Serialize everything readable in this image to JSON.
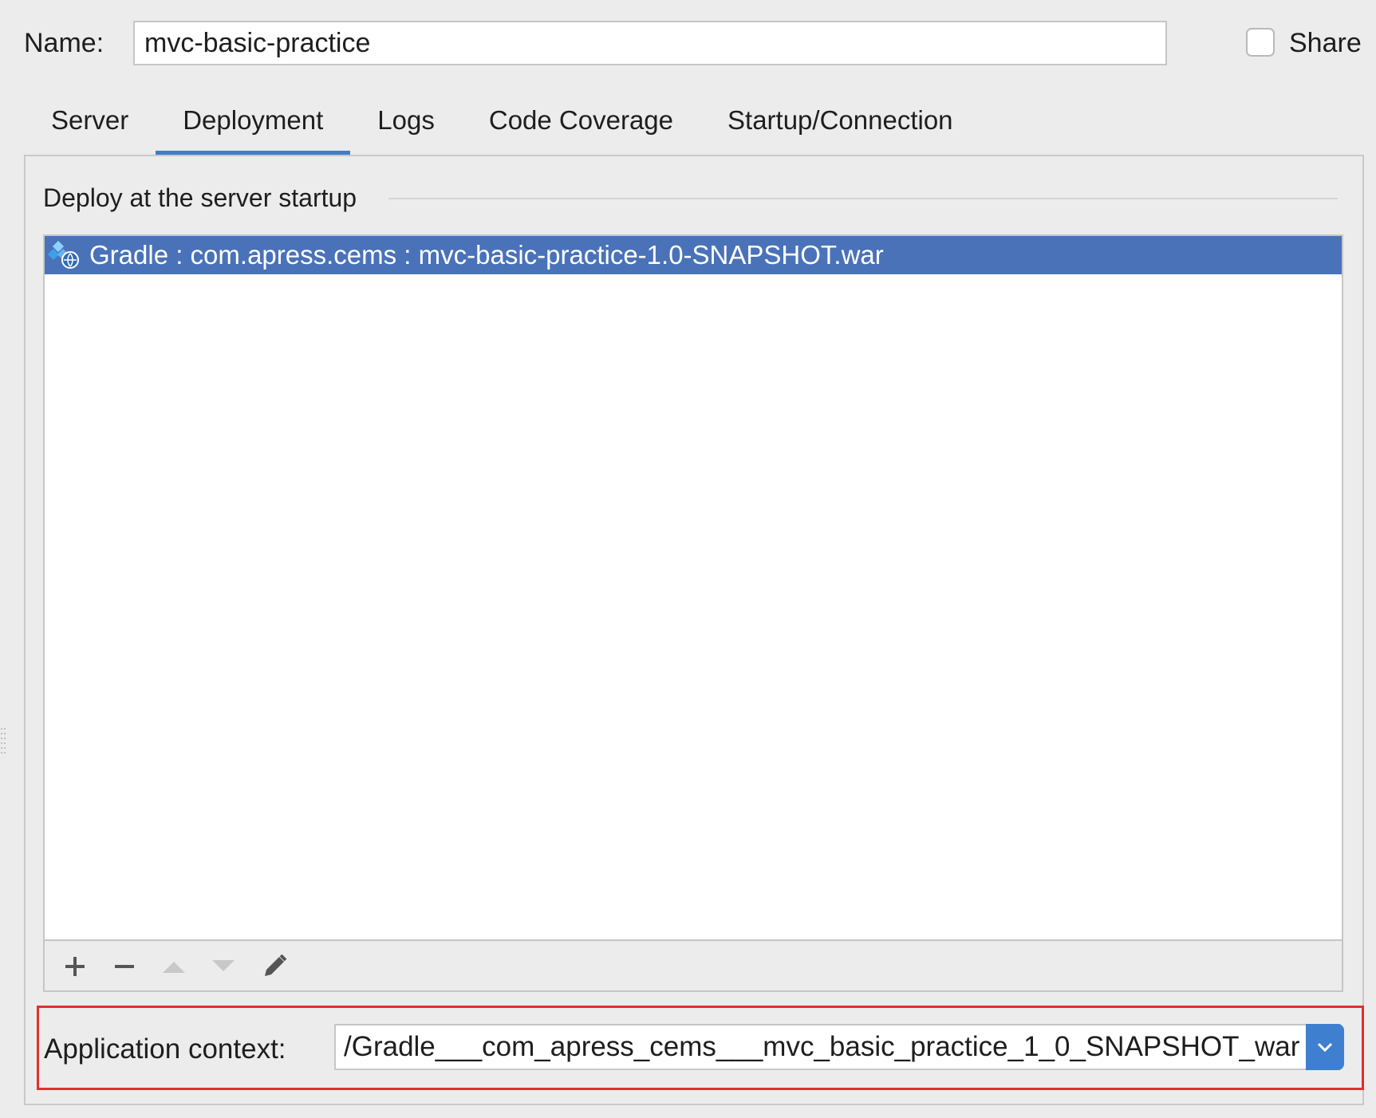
{
  "name": {
    "label": "Name:",
    "value": "mvc-basic-practice"
  },
  "share": {
    "label": "Share",
    "checked": false
  },
  "tabs": [
    {
      "label": "Server",
      "active": false
    },
    {
      "label": "Deployment",
      "active": true
    },
    {
      "label": "Logs",
      "active": false
    },
    {
      "label": "Code Coverage",
      "active": false
    },
    {
      "label": "Startup/Connection",
      "active": false
    }
  ],
  "deployment": {
    "section_title": "Deploy at the server startup",
    "items": [
      {
        "label": "Gradle : com.apress.cems : mvc-basic-practice-1.0-SNAPSHOT.war",
        "icon": "gradle-artifact-icon",
        "selected": true
      }
    ],
    "toolbar": {
      "add_icon": "plus-icon",
      "remove_icon": "minus-icon",
      "move_up_icon": "arrow-up-icon",
      "move_down_icon": "arrow-down-icon",
      "edit_icon": "pencil-icon"
    }
  },
  "app_context": {
    "label": "Application context:",
    "value": "/Gradle___com_apress_cems___mvc_basic_practice_1_0_SNAPSHOT_war"
  },
  "colors": {
    "accent": "#3d7fc8",
    "selection": "#4a72b8",
    "highlight_border": "#e0302e",
    "dropdown": "#3f7fd0"
  }
}
